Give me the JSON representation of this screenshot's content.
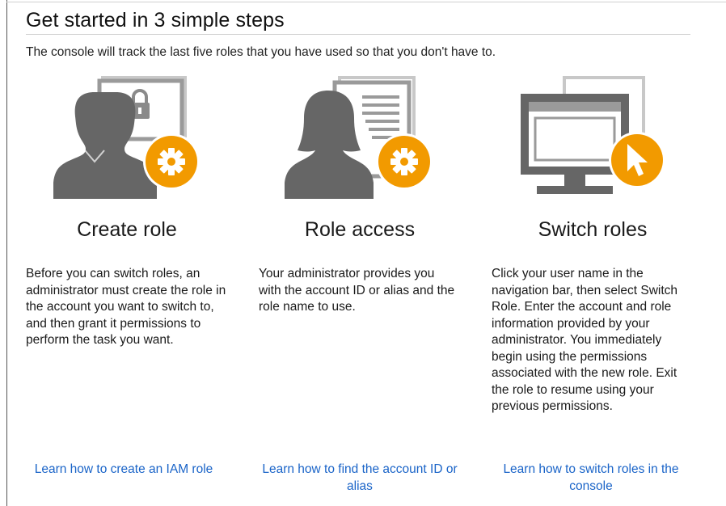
{
  "header": {
    "title": "Get started in 3 simple steps",
    "subtitle": "The console will track the last five roles that you have used so that you don't have to."
  },
  "colors": {
    "accent_orange": "#F29A00",
    "icon_gray": "#666666",
    "link_blue": "#1A64C8"
  },
  "steps": [
    {
      "icon": "person-lock-gear-icon",
      "heading": "Create role",
      "description": "Before you can switch roles, an administrator must create the role in the account you want to switch to, and then grant it permissions to perform the task you want.",
      "link": "Learn how to create an IAM role"
    },
    {
      "icon": "person-document-gear-icon",
      "heading": "Role access",
      "description": "Your administrator provides you with the account ID or alias and the role name to use.",
      "link": "Learn how to find the account ID or alias"
    },
    {
      "icon": "monitor-cursor-icon",
      "heading": "Switch roles",
      "description": "Click your user name in the navigation bar, then select Switch Role. Enter the account and role information provided by your administrator. You immediately begin using the permissions associated with the new role. Exit the role to resume using your previous permissions.",
      "link": "Learn how to switch roles in the console"
    }
  ]
}
